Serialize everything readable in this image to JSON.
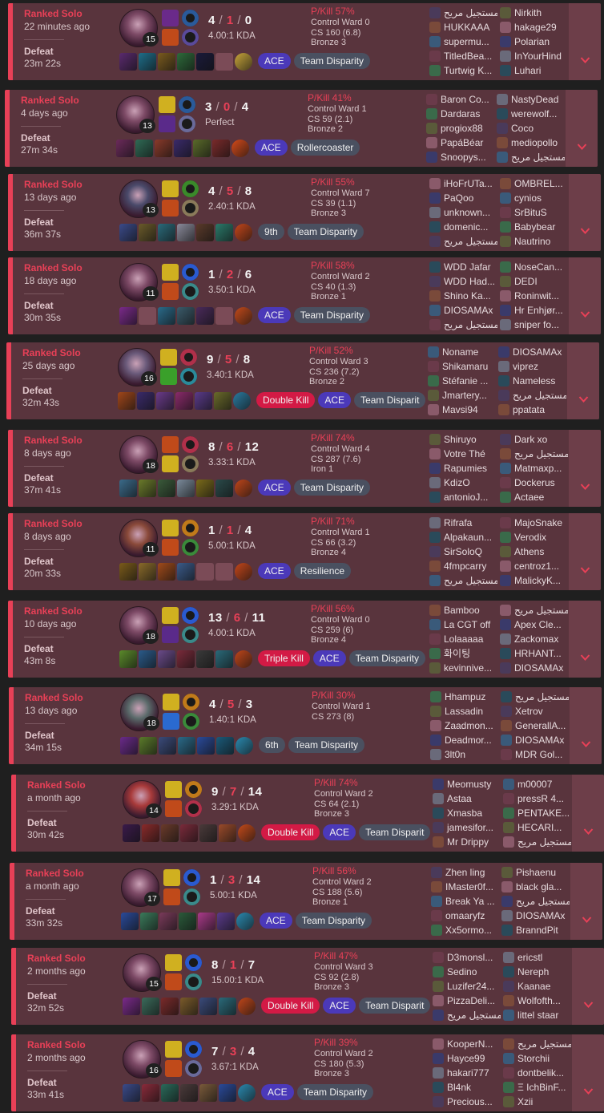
{
  "matches": [
    {
      "queue": "Ranked Solo",
      "ago": "22 minutes ago",
      "result": "Defeat",
      "duration": "23m 22s",
      "level": "15",
      "k": "4",
      "d": "1",
      "a": "0",
      "kda_ratio": "4.00:1 KDA",
      "pkill": "P/Kill 57%",
      "stats": [
        "Control Ward 0",
        "CS 160 (6.8)",
        "Bronze 3"
      ],
      "badges": [
        "ACE",
        "Team Disparity"
      ],
      "blue": [
        "مستجيل مريح",
        "HUKKAAA",
        "supermu...",
        "TitledBea...",
        "Turtwig K..."
      ],
      "red": [
        "Nirkith",
        "hakage29",
        "Polarian",
        "InYourHind",
        "Luhari"
      ]
    },
    {
      "queue": "Ranked Solo",
      "ago": "4 days ago",
      "result": "Defeat",
      "duration": "27m 34s",
      "level": "13",
      "k": "3",
      "d": "0",
      "a": "4",
      "kda_ratio": "Perfect",
      "pkill": "P/Kill 41%",
      "stats": [
        "Control Ward 1",
        "CS 59 (2.1)",
        "Bronze 2"
      ],
      "badges": [
        "ACE",
        "Rollercoaster"
      ],
      "blue": [
        "Baron Co...",
        "Dardaras",
        "progiox88",
        "PapáBéar",
        "Snoopys..."
      ],
      "red": [
        "NastyDead",
        "werewolf...",
        "Coco",
        "mediopollo",
        "مستجيل مريح"
      ]
    },
    {
      "queue": "Ranked Solo",
      "ago": "13 days ago",
      "result": "Defeat",
      "duration": "36m 37s",
      "level": "13",
      "k": "4",
      "d": "5",
      "a": "8",
      "kda_ratio": "2.40:1 KDA",
      "pkill": "P/Kill 55%",
      "stats": [
        "Control Ward 7",
        "CS 39 (1.1)",
        "Bronze 3"
      ],
      "badges": [
        "9th",
        "Team Disparity"
      ],
      "blue": [
        "iHoFrUTa...",
        "PaQoo",
        "unknown...",
        "domenic...",
        "مستجيل مريح"
      ],
      "red": [
        "OMBREL...",
        "cynios",
        "SrBituS",
        "Babybear",
        "Nautrino"
      ]
    },
    {
      "queue": "Ranked Solo",
      "ago": "18 days ago",
      "result": "Defeat",
      "duration": "30m 35s",
      "level": "11",
      "k": "1",
      "d": "2",
      "a": "6",
      "kda_ratio": "3.50:1 KDA",
      "pkill": "P/Kill 58%",
      "stats": [
        "Control Ward 2",
        "CS 40 (1.3)",
        "Bronze 1"
      ],
      "badges": [
        "ACE",
        "Team Disparity"
      ],
      "blue": [
        "WDD Jafar",
        "WDD Had...",
        "Shino Ka...",
        "DIOSAMAx",
        "مستجيل مريح"
      ],
      "red": [
        "NoseCan...",
        "DEDI",
        "Roninwit...",
        "Hr Enhjør...",
        "sniper fo..."
      ]
    },
    {
      "queue": "Ranked Solo",
      "ago": "25 days ago",
      "result": "Defeat",
      "duration": "32m 43s",
      "level": "16",
      "k": "9",
      "d": "5",
      "a": "8",
      "kda_ratio": "3.40:1 KDA",
      "pkill": "P/Kill 52%",
      "stats": [
        "Control Ward 3",
        "CS 236 (7.2)",
        "Bronze 2"
      ],
      "badges": [
        "Double Kill",
        "ACE",
        "Team Disparit"
      ],
      "blue": [
        "Noname",
        "Shikamaru",
        "Stéfanie ...",
        "Jmartery...",
        "Mavsi94"
      ],
      "red": [
        "DIOSAMAx",
        "viprez",
        "Nameless",
        "مستجيل مريح",
        "ppatata"
      ]
    },
    {
      "queue": "Ranked Solo",
      "ago": "8 days ago",
      "result": "Defeat",
      "duration": "37m 41s",
      "level": "18",
      "k": "8",
      "d": "6",
      "a": "12",
      "kda_ratio": "3.33:1 KDA",
      "pkill": "P/Kill 74%",
      "stats": [
        "Control Ward 4",
        "CS 287 (7.6)",
        "Iron 1"
      ],
      "badges": [
        "ACE",
        "Team Disparity"
      ],
      "blue": [
        "Shiruyo",
        "Votre Thé",
        "Rapumies",
        "KdizO",
        "antonioJ..."
      ],
      "red": [
        "Dark xo",
        "مستجيل مريح",
        "Matmaxp...",
        "Dockerus",
        "Actaee"
      ]
    },
    {
      "queue": "Ranked Solo",
      "ago": "8 days ago",
      "result": "Defeat",
      "duration": "20m 33s",
      "level": "11",
      "k": "1",
      "d": "1",
      "a": "4",
      "kda_ratio": "5.00:1 KDA",
      "pkill": "P/Kill 71%",
      "stats": [
        "Control Ward 1",
        "CS 66 (3.2)",
        "Bronze 4"
      ],
      "badges": [
        "ACE",
        "Resilience"
      ],
      "blue": [
        "Rifrafa",
        "Alpakaun...",
        "SirSoloQ",
        "4fmpcarry",
        "مستجيل مريح"
      ],
      "red": [
        "MajoSnake",
        "Verodix",
        "Athens",
        "centroz1...",
        "MalickyK..."
      ]
    },
    {
      "queue": "Ranked Solo",
      "ago": "10 days ago",
      "result": "Defeat",
      "duration": "43m 8s",
      "level": "18",
      "k": "13",
      "d": "6",
      "a": "11",
      "kda_ratio": "4.00:1 KDA",
      "pkill": "P/Kill 56%",
      "stats": [
        "Control Ward 0",
        "CS 259 (6)",
        "Bronze 4"
      ],
      "badges": [
        "Triple Kill",
        "ACE",
        "Team Disparity"
      ],
      "blue": [
        "Bamboo",
        "La CGT off",
        "Lolaaaaa",
        "화이팅",
        "kevinnive..."
      ],
      "red": [
        "مستجيل مريح",
        "Apex Cle...",
        "Zackomax",
        "HRHANT...",
        "DIOSAMAx"
      ]
    },
    {
      "queue": "Ranked Solo",
      "ago": "13 days ago",
      "result": "Defeat",
      "duration": "34m 15s",
      "level": "18",
      "k": "4",
      "d": "5",
      "a": "3",
      "kda_ratio": "1.40:1 KDA",
      "pkill": "P/Kill 30%",
      "stats": [
        "Control Ward 1",
        "CS 273 (8)"
      ],
      "badges": [
        "6th",
        "Team Disparity"
      ],
      "blue": [
        "Hhampuz",
        "Lassadin",
        "Zaadmon...",
        "Deadmor...",
        "3lt0n"
      ],
      "red": [
        "مستجيل مريح",
        "Xetrov",
        "GenerallA...",
        "DIOSAMAx",
        "MDR Gol..."
      ]
    },
    {
      "queue": "Ranked Solo",
      "ago": "a month ago",
      "result": "Defeat",
      "duration": "30m 42s",
      "level": "14",
      "k": "9",
      "d": "7",
      "a": "14",
      "kda_ratio": "3.29:1 KDA",
      "pkill": "P/Kill 74%",
      "stats": [
        "Control Ward 2",
        "CS 64 (2.1)",
        "Bronze 3"
      ],
      "badges": [
        "Double Kill",
        "ACE",
        "Team Disparit"
      ],
      "blue": [
        "Meomusty",
        "Astaa",
        "Xmasba",
        "jamesifor...",
        "Mr Drippy"
      ],
      "red": [
        "m00007",
        "pressR 4...",
        "PENTAKE...",
        "HECARI...",
        "مستجيل مريح"
      ]
    },
    {
      "queue": "Ranked Solo",
      "ago": "a month ago",
      "result": "Defeat",
      "duration": "33m 32s",
      "level": "17",
      "k": "1",
      "d": "3",
      "a": "14",
      "kda_ratio": "5.00:1 KDA",
      "pkill": "P/Kill 56%",
      "stats": [
        "Control Ward 2",
        "CS 188 (5.6)",
        "Bronze 1"
      ],
      "badges": [
        "ACE",
        "Team Disparity"
      ],
      "blue": [
        "Zhen ling",
        "IMaster0f...",
        "Break Ya ...",
        "omaaryfz",
        "Xx5ormo..."
      ],
      "red": [
        "Pishaenu",
        "black gla...",
        "مستجيل مريح",
        "DIOSAMAx",
        "BranndPit"
      ]
    },
    {
      "queue": "Ranked Solo",
      "ago": "2 months ago",
      "result": "Defeat",
      "duration": "32m 52s",
      "level": "15",
      "k": "8",
      "d": "1",
      "a": "7",
      "kda_ratio": "15.00:1 KDA",
      "pkill": "P/Kill 47%",
      "stats": [
        "Control Ward 3",
        "CS 92 (2.8)",
        "Bronze 3"
      ],
      "badges": [
        "Double Kill",
        "ACE",
        "Team Disparit"
      ],
      "blue": [
        "D3monsl...",
        "Sedino",
        "Luzifer24...",
        "PizzaDeli...",
        "مستجيل مريح"
      ],
      "red": [
        "ericstl",
        "Nereph",
        "Kaanae",
        "Wolfofth...",
        "littel staar"
      ]
    },
    {
      "queue": "Ranked Solo",
      "ago": "2 months ago",
      "result": "Defeat",
      "duration": "33m 41s",
      "level": "16",
      "k": "7",
      "d": "3",
      "a": "4",
      "kda_ratio": "3.67:1 KDA",
      "pkill": "P/Kill 39%",
      "stats": [
        "Control Ward 2",
        "CS 180 (5.3)",
        "Bronze 3"
      ],
      "badges": [
        "ACE",
        "Team Disparity"
      ],
      "blue": [
        "KooperN...",
        "Hayce99",
        "hakari777",
        "Bl4nk",
        "Precious..."
      ],
      "red": [
        "مستجيل مريح",
        "Storchii",
        "dontbelik...",
        "Ξ IchBinF...",
        "Xzii"
      ]
    }
  ],
  "colors": {
    "card_bg": "#59343d",
    "accent_red": "#e84057",
    "ace_badge": "#4b39b9",
    "multikill_badge": "#d31a45",
    "expand_bg": "#6d3e49"
  },
  "icons": {
    "expand": "chevron-down-icon",
    "champion": "champion-portrait-icon",
    "spell": "summoner-spell-icon",
    "rune": "rune-icon",
    "item": "item-icon"
  }
}
